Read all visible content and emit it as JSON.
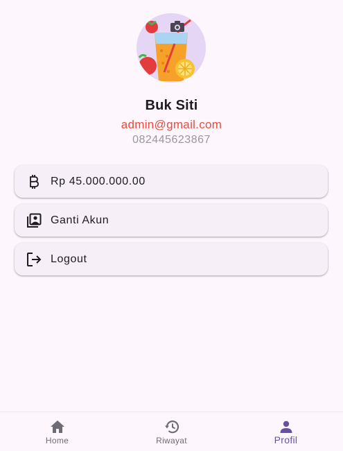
{
  "profile": {
    "avatar_icon": "juice-glass-illustration",
    "camera_icon": "camera-icon",
    "name": "Buk Siti",
    "email": "admin@gmail.com",
    "phone": "082445623867"
  },
  "menu": [
    {
      "icon": "bitcoin-icon",
      "label": "Rp 45.000.000.00"
    },
    {
      "icon": "switch-account-icon",
      "label": "Ganti Akun"
    },
    {
      "icon": "logout-icon",
      "label": "Logout"
    }
  ],
  "nav": {
    "items": [
      {
        "icon": "home-icon",
        "label": "Home"
      },
      {
        "icon": "history-icon",
        "label": "Riwayat"
      },
      {
        "icon": "person-icon",
        "label": "Profil"
      }
    ],
    "active_index": 2
  },
  "colors": {
    "background": "#fdf7fd",
    "email": "#e94b3c",
    "accent": "#6750a4",
    "tile": "#f6eff7"
  }
}
